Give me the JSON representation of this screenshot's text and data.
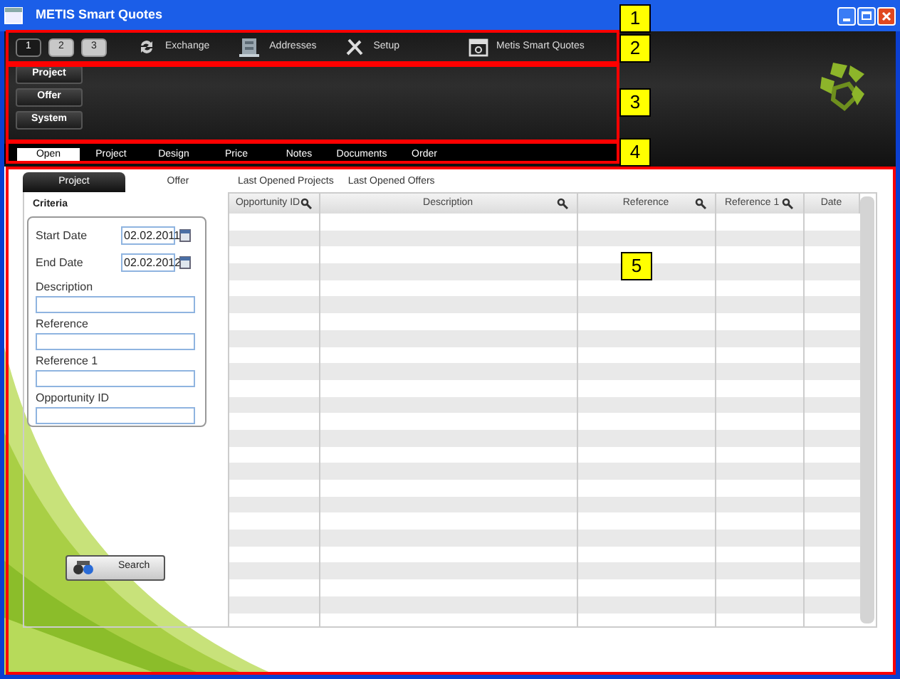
{
  "window": {
    "title": "METIS Smart Quotes"
  },
  "pages": [
    {
      "label": "1",
      "selected": true
    },
    {
      "label": "2",
      "selected": false
    },
    {
      "label": "3",
      "selected": false
    }
  ],
  "toolbar": [
    {
      "label": "Exchange",
      "kind": "exchange"
    },
    {
      "label": "Addresses",
      "kind": "addresses"
    },
    {
      "label": "Setup",
      "kind": "setup"
    },
    {
      "label": "Metis Smart Quotes",
      "kind": "app"
    }
  ],
  "side_buttons": [
    "Project",
    "Offer",
    "System"
  ],
  "tabs": [
    {
      "label": "Open",
      "selected": true
    },
    {
      "label": "Project",
      "selected": false
    },
    {
      "label": "Design",
      "selected": false
    },
    {
      "label": "Price",
      "selected": false
    },
    {
      "label": "Notes",
      "selected": false
    },
    {
      "label": "Documents",
      "selected": false
    },
    {
      "label": "Order",
      "selected": false
    }
  ],
  "subtabs": [
    {
      "label": "Project",
      "selected": true
    },
    {
      "label": "Offer",
      "selected": false
    },
    {
      "label": "Last Opened Projects",
      "selected": false
    },
    {
      "label": "Last Opened Offers",
      "selected": false
    }
  ],
  "criteria": {
    "title": "Criteria",
    "fields": [
      {
        "label": "Start Date",
        "value": "02.02.2011",
        "kind": "date"
      },
      {
        "label": "End Date",
        "value": "02.02.2012",
        "kind": "date"
      },
      {
        "label": "Description",
        "kind": "text"
      },
      {
        "label": "Reference",
        "kind": "text"
      },
      {
        "label": "Reference 1",
        "kind": "text"
      },
      {
        "label": "Opportunity ID",
        "kind": "text"
      }
    ],
    "search_button": "Search"
  },
  "table": {
    "columns": [
      {
        "label": "Opportunity ID",
        "searchable": true
      },
      {
        "label": "Description",
        "searchable": true
      },
      {
        "label": "Reference",
        "searchable": true
      },
      {
        "label": "Reference 1",
        "searchable": true
      },
      {
        "label": "Date",
        "searchable": false
      }
    ]
  },
  "callouts": [
    "1",
    "2",
    "3",
    "4",
    "5"
  ]
}
